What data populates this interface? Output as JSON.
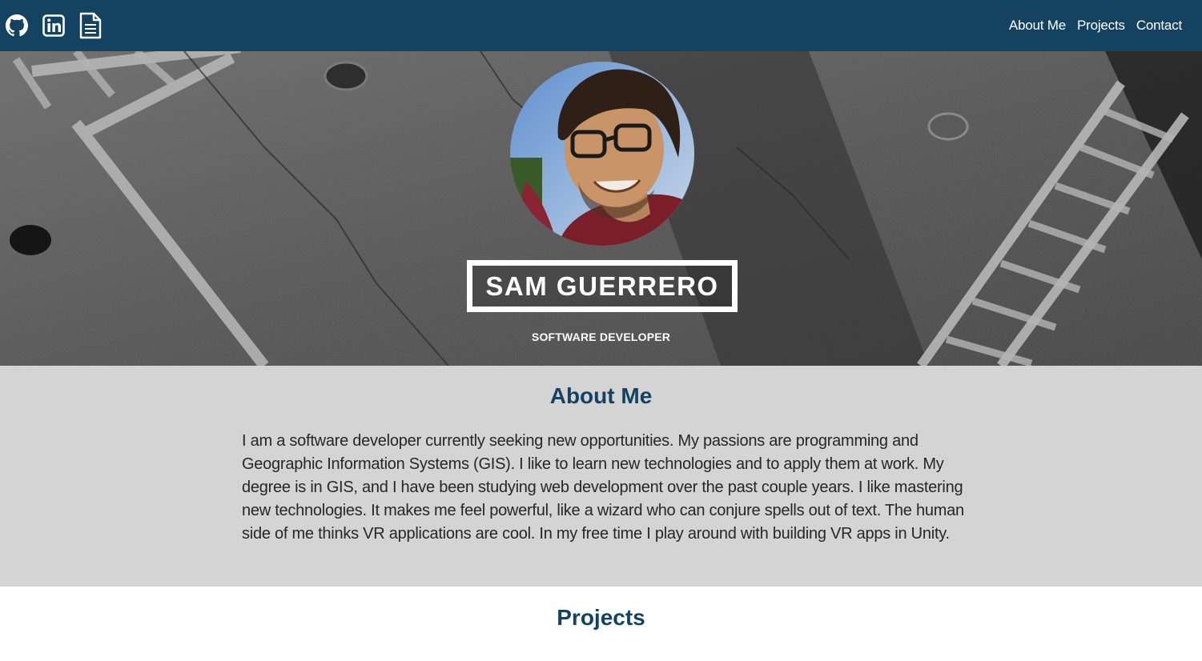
{
  "header": {
    "social": [
      {
        "icon": "github-icon"
      },
      {
        "icon": "linkedin-icon"
      },
      {
        "icon": "resume-document-icon"
      }
    ],
    "nav": [
      {
        "label": "About Me"
      },
      {
        "label": "Projects"
      },
      {
        "label": "Contact"
      }
    ]
  },
  "hero": {
    "name": "SAM GUERRERO",
    "subtitle": "SOFTWARE DEVELOPER"
  },
  "about": {
    "title": "About Me",
    "body": "I am a software developer currently seeking new opportunities. My passions are programming and Geographic Information Systems (GIS). I like to learn new technologies and to apply them at work. My degree is in GIS, and I have been studying web development over the past couple years. I like mastering new technologies. It makes me feel powerful, like a wizard who can conjure spells out of text. The human side of me thinks VR applications are cool. In my free time I play around with building VR apps in Unity."
  },
  "projects": {
    "title": "Projects"
  },
  "colors": {
    "nav_bg": "#144361",
    "accent": "#144361",
    "about_bg": "#d4d4d4"
  }
}
